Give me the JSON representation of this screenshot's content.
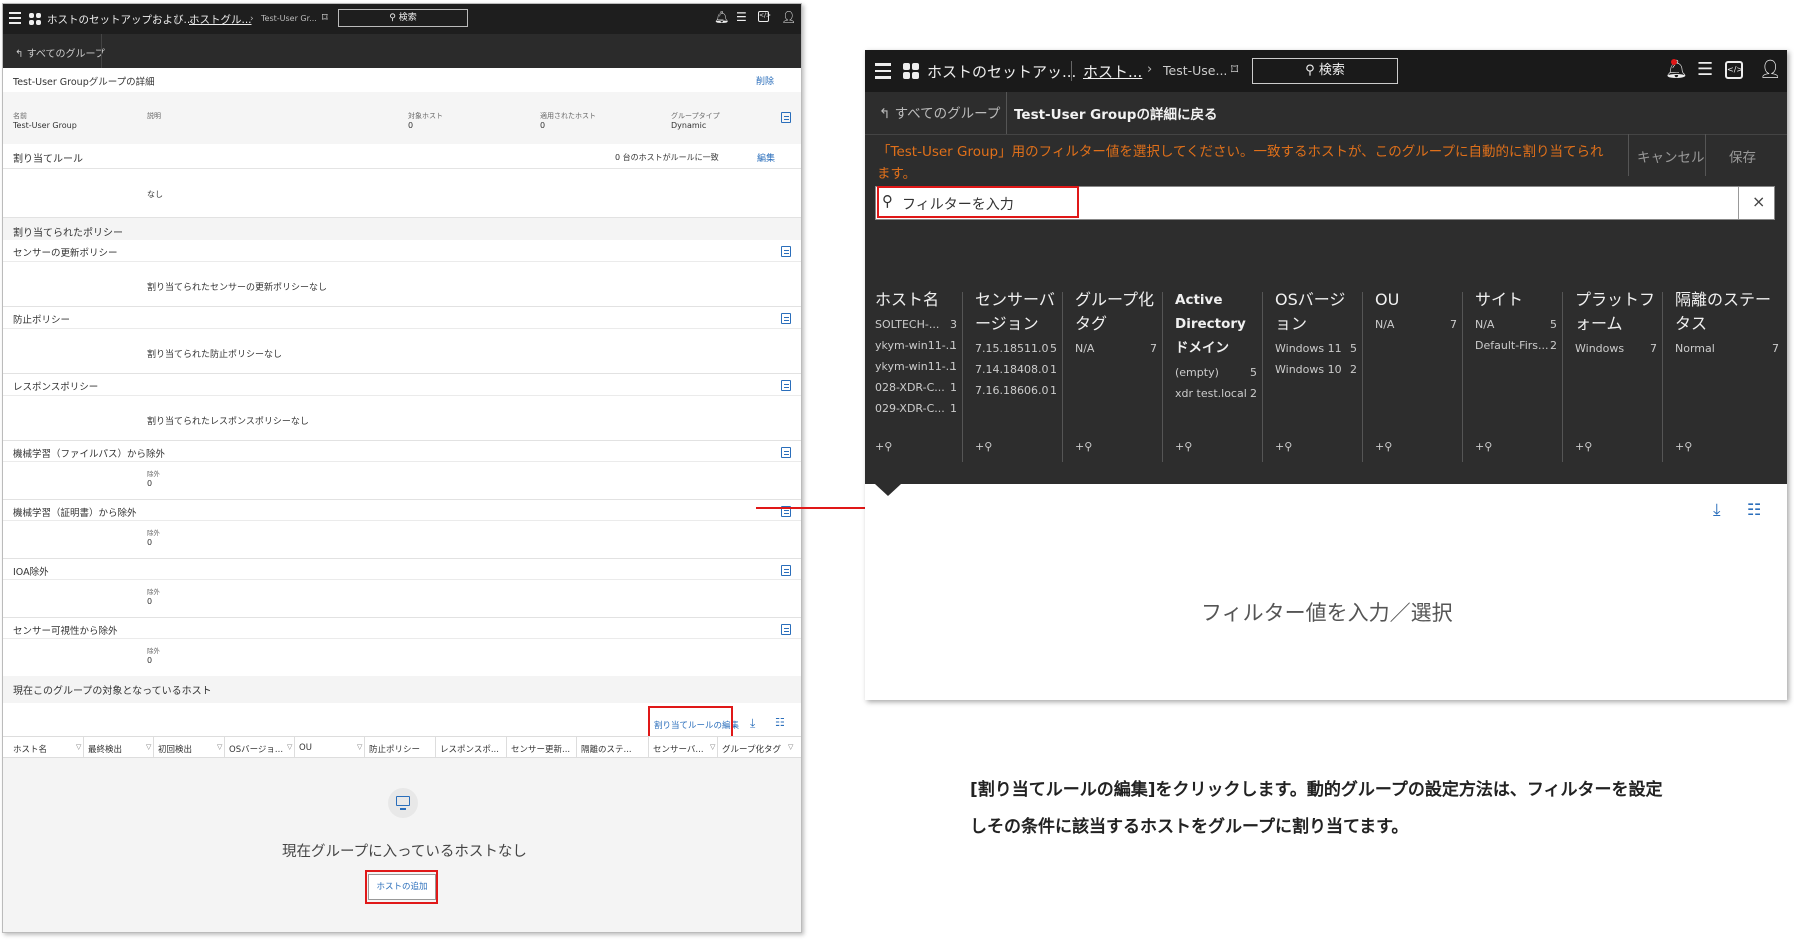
{
  "left": {
    "topbar": {
      "title": "ホストのセットアップおよび...",
      "crumb1": "ホストグル...",
      "crumb2": "Test-User Gr...",
      "search": "検索"
    },
    "back_label": "すべてのグループ",
    "details": {
      "title": "Test-User Groupグループの詳細",
      "delete": "削除",
      "fields": [
        {
          "label": "名前",
          "value": "Test-User Group"
        },
        {
          "label": "説明",
          "value": ""
        },
        {
          "label": "対象ホスト",
          "value": "0"
        },
        {
          "label": "適用されたホスト",
          "value": "0"
        },
        {
          "label": "グループタイプ",
          "value": "Dynamic"
        }
      ]
    },
    "rules": {
      "title": "割り当てルール",
      "match": "0 台のホストがルールに一致",
      "edit": "編集",
      "none": "なし"
    },
    "policies_title": "割り当てられたポリシー",
    "policies": [
      {
        "name": "センサーの更新ポリシー",
        "text": "割り当てられたセンサーの更新ポリシーなし"
      },
      {
        "name": "防止ポリシー",
        "text": "割り当てられた防止ポリシーなし"
      },
      {
        "name": "レスポンスポリシー",
        "text": "割り当てられたレスポンスポリシーなし"
      }
    ],
    "exclusions": [
      {
        "name": "機械学習（ファイルパス）から除外",
        "label": "除外",
        "value": "0"
      },
      {
        "name": "機械学習（証明書）から除外",
        "label": "除外",
        "value": "0"
      },
      {
        "name": "IOA除外",
        "label": "除外",
        "value": "0"
      },
      {
        "name": "センサー可視性から除外",
        "label": "除外",
        "value": "0"
      }
    ],
    "hosts": {
      "title": "現在このグループの対象となっているホスト",
      "edit_rules": "割り当てルールの編集",
      "columns": [
        "ホスト名",
        "最終検出",
        "初回検出",
        "OSバージョ...",
        "OU",
        "防止ポリシー",
        "レスポンスポ...",
        "センサー更新...",
        "隔離のステ...",
        "センサーバ...",
        "グループ化タグ"
      ],
      "empty": "現在グループに入っているホストなし",
      "add": "ホストの追加"
    }
  },
  "right": {
    "topbar": {
      "title": "ホストのセットアッ...",
      "crumb1": "ホスト...",
      "crumb2": "Test-Use...",
      "search": "検索"
    },
    "back_all": "すべてのグループ",
    "back_detail": "Test-User Groupの詳細に戻る",
    "instruction": "「Test-User Group」用のフィルター値を選択してください。一致するホストが、このグループに自動的に割り当てられます。",
    "instruction_line1": "「Test-User Group」用のフィルター値を選択してください。一致するホストが、このグループに自動的に割り当てられ",
    "instruction_line2": "ます。",
    "cancel": "キャンセル",
    "save": "保存",
    "filter_placeholder": "フィルターを入力",
    "close": "×",
    "columns": [
      {
        "title": "ホスト名",
        "rows": [
          [
            "SOLTECH-...",
            "3"
          ],
          [
            "ykym-win11-...",
            "1"
          ],
          [
            "ykym-win11-...",
            "1"
          ],
          [
            "028-XDR-C...",
            "1"
          ],
          [
            "029-XDR-C...",
            "1"
          ]
        ]
      },
      {
        "title": "センサーバージョン",
        "rows": [
          [
            "7.15.18511.0",
            "5"
          ],
          [
            "7.14.18408.0",
            "1"
          ],
          [
            "7.16.18606.0",
            "1"
          ]
        ]
      },
      {
        "title": "グループ化タグ",
        "rows": [
          [
            "N/A",
            "7"
          ]
        ]
      },
      {
        "title": "Active Directoryドメイン",
        "rows": [
          [
            "(empty)",
            "5"
          ],
          [
            "xdr test.local",
            "2"
          ]
        ]
      },
      {
        "title": "OSバージョン",
        "rows": [
          [
            "Windows 11",
            "5"
          ],
          [
            "Windows 10",
            "2"
          ]
        ]
      },
      {
        "title": "OU",
        "rows": [
          [
            "N/A",
            "7"
          ]
        ]
      },
      {
        "title": "サイト",
        "rows": [
          [
            "N/A",
            "5"
          ],
          [
            "Default-Firs...",
            "2"
          ]
        ]
      },
      {
        "title": "プラットフォーム",
        "rows": [
          [
            "Windows",
            "7"
          ]
        ]
      },
      {
        "title": "隔離のステータス",
        "rows": [
          [
            "Normal",
            "7"
          ]
        ]
      }
    ],
    "add_filter": "+",
    "empty_prompt": "フィルター値を入力／選択"
  },
  "caption_line1": "[割り当てルールの編集]をクリックします。動的グループの設定方法は、フィルターを設定",
  "caption_line2": "しその条件に該当するホストをグループに割り当てます。",
  "colors": {
    "accent_red": "#e01818",
    "instruction_orange": "#e0701a",
    "link_blue": "#2a6ebb"
  }
}
